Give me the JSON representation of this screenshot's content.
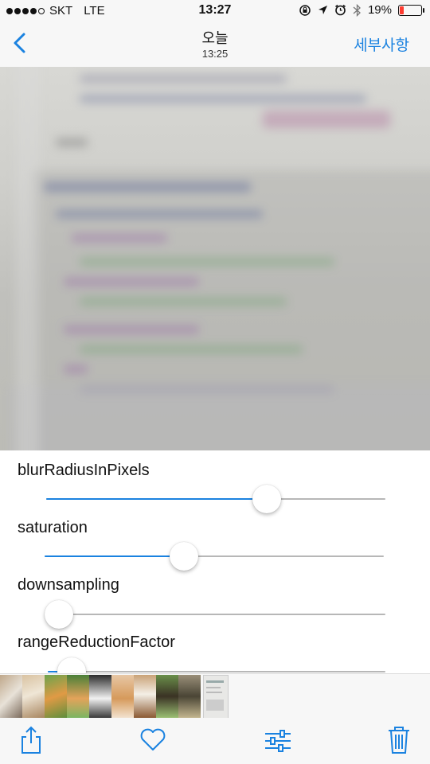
{
  "status": {
    "carrier": "SKT",
    "network": "LTE",
    "time": "13:27",
    "battery": "19%",
    "battery_level": 0.19
  },
  "nav": {
    "back_icon": "chevron-left-icon",
    "title": "오늘",
    "subtitle": "13:25",
    "right_label": "세부사항"
  },
  "sliders": [
    {
      "label": "blurRadiusInPixels",
      "value": 0.65
    },
    {
      "label": "saturation",
      "value": 0.41
    },
    {
      "label": "downsampling",
      "value": 0.0
    },
    {
      "label": "rangeReductionFactor",
      "value": 0.07
    }
  ],
  "toolbar": {
    "share_icon": "share-icon",
    "favorite_icon": "heart-icon",
    "adjust_icon": "sliders-icon",
    "delete_icon": "trash-icon"
  },
  "colors": {
    "accent": "#1a82e0",
    "battery_low": "#ff3b30"
  }
}
